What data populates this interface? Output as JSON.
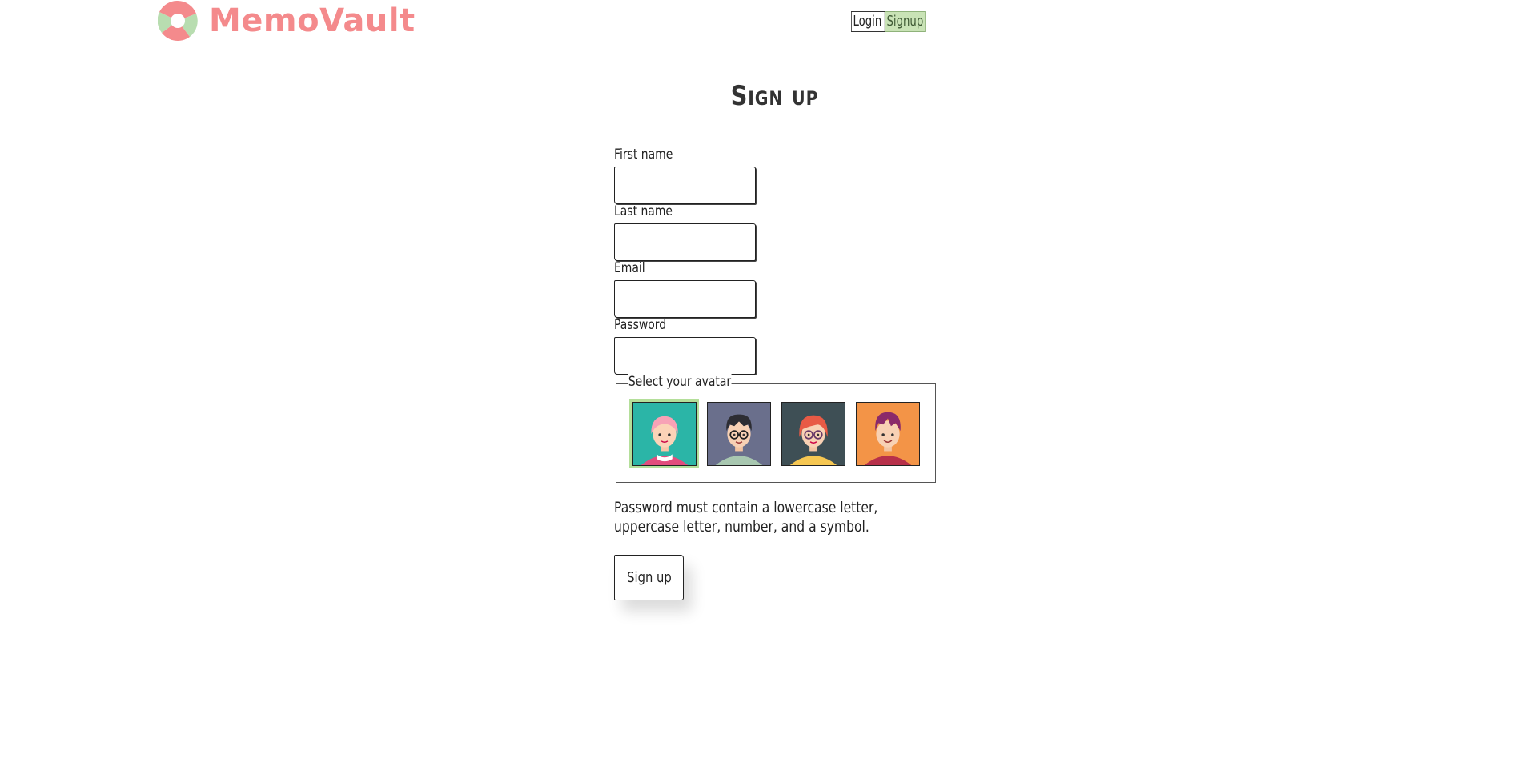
{
  "app": {
    "name": "MemoVault",
    "brand_color": "#f48a8c",
    "accent_color": "#c9e3b6"
  },
  "nav": {
    "login_label": "Login",
    "signup_label": "Signup"
  },
  "page": {
    "title": "Sign up"
  },
  "form": {
    "first_name_label": "First name",
    "first_name_value": "",
    "last_name_label": "Last name",
    "last_name_value": "",
    "email_label": "Email",
    "email_value": "",
    "password_label": "Password",
    "password_value": "",
    "avatar_legend": "Select your avatar",
    "avatars": [
      {
        "name": "avatar-pink-hair-girl",
        "bg": "#2bb5a7",
        "selected": true
      },
      {
        "name": "avatar-glasses-boy",
        "bg": "#6a6f8c",
        "selected": false
      },
      {
        "name": "avatar-red-hair-glasses-girl",
        "bg": "#3e4f55",
        "selected": false
      },
      {
        "name": "avatar-purple-hair-boy",
        "bg": "#f39447",
        "selected": false
      }
    ],
    "password_hint": "Password must contain a lowercase letter, uppercase letter, number, and a symbol.",
    "submit_label": "Sign up"
  }
}
